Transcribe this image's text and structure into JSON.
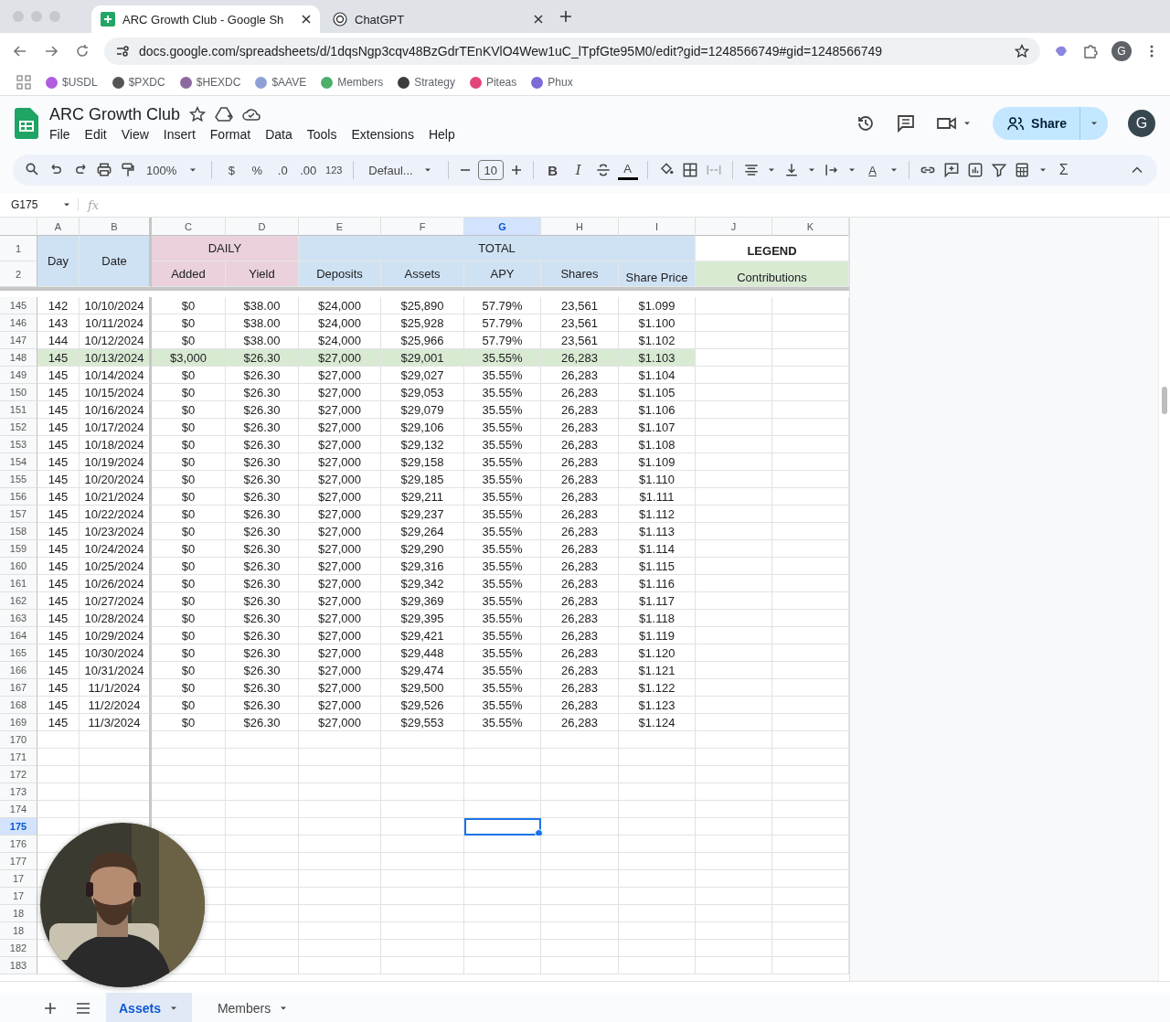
{
  "browser": {
    "tabs": [
      {
        "title": "ARC Growth Club - Google Sh",
        "selected": true,
        "kind": "sheets"
      },
      {
        "title": "ChatGPT",
        "selected": false,
        "kind": "chat"
      }
    ],
    "url": "docs.google.com/spreadsheets/d/1dqsNgp3cqv48BzGdrTEnKVlO4Wew1uC_lTpfGte95M0/edit?gid=1248566749#gid=1248566749",
    "profile": "G",
    "bookmarks": [
      {
        "label": "$USDL",
        "color": "#b05ce0"
      },
      {
        "label": "$PXDC",
        "color": "#555555"
      },
      {
        "label": "$HEXDC",
        "color": "#8a6a9e"
      },
      {
        "label": "$AAVE",
        "color": "#8fa0d8"
      },
      {
        "label": "Members",
        "color": "#4caf6a"
      },
      {
        "label": "Strategy",
        "color": "#3c3c3c"
      },
      {
        "label": "Piteas",
        "color": "#e0457b"
      },
      {
        "label": "Phux",
        "color": "#7b6bd6"
      }
    ]
  },
  "doc": {
    "title": "ARC Growth Club",
    "menu": [
      "File",
      "Edit",
      "View",
      "Insert",
      "Format",
      "Data",
      "Tools",
      "Extensions",
      "Help"
    ],
    "share": "Share",
    "avatar": "G"
  },
  "toolbar": {
    "zoom": "100%",
    "currency": "$",
    "percent": "%",
    "dec_decrease": ".0",
    "dec_increase": ".00",
    "number_format": "123",
    "font": "Defaul...",
    "font_size": "10",
    "bold": "B",
    "italic": "I",
    "text_color": "A",
    "text_rotation": "A",
    "sum": "Σ"
  },
  "name_box": "G175",
  "fx": "fx",
  "columns": [
    {
      "label": "A",
      "selected": false
    },
    {
      "label": "B",
      "selected": false
    },
    {
      "label": "C",
      "selected": false
    },
    {
      "label": "D",
      "selected": false
    },
    {
      "label": "E",
      "selected": false
    },
    {
      "label": "F",
      "selected": false
    },
    {
      "label": "G",
      "selected": true
    },
    {
      "label": "H",
      "selected": false
    },
    {
      "label": "I",
      "selected": false
    },
    {
      "label": "J",
      "selected": false
    },
    {
      "label": "K",
      "selected": false
    }
  ],
  "header": {
    "row_labels": [
      "1",
      "2"
    ],
    "day": "Day",
    "date": "Date",
    "daily": "DAILY",
    "total": "TOTAL",
    "legend": "LEGEND",
    "sub": [
      "Added",
      "Yield",
      "Deposits",
      "Assets",
      "APY",
      "Shares",
      "Share Price"
    ],
    "contributions": "Contributions"
  },
  "rows": [
    {
      "n": "145",
      "selected": false,
      "highlighted": false,
      "cells": [
        "142",
        "10/10/2024",
        "$0",
        "$38.00",
        "$24,000",
        "$25,890",
        "57.79%",
        "23,561",
        "$1.099"
      ]
    },
    {
      "n": "146",
      "selected": false,
      "highlighted": false,
      "cells": [
        "143",
        "10/11/2024",
        "$0",
        "$38.00",
        "$24,000",
        "$25,928",
        "57.79%",
        "23,561",
        "$1.100"
      ]
    },
    {
      "n": "147",
      "selected": false,
      "highlighted": false,
      "cells": [
        "144",
        "10/12/2024",
        "$0",
        "$38.00",
        "$24,000",
        "$25,966",
        "57.79%",
        "23,561",
        "$1.102"
      ]
    },
    {
      "n": "148",
      "selected": false,
      "highlighted": true,
      "cells": [
        "145",
        "10/13/2024",
        "$3,000",
        "$26.30",
        "$27,000",
        "$29,001",
        "35.55%",
        "26,283",
        "$1.103"
      ]
    },
    {
      "n": "149",
      "selected": false,
      "highlighted": false,
      "cells": [
        "145",
        "10/14/2024",
        "$0",
        "$26.30",
        "$27,000",
        "$29,027",
        "35.55%",
        "26,283",
        "$1.104"
      ]
    },
    {
      "n": "150",
      "selected": false,
      "highlighted": false,
      "cells": [
        "145",
        "10/15/2024",
        "$0",
        "$26.30",
        "$27,000",
        "$29,053",
        "35.55%",
        "26,283",
        "$1.105"
      ]
    },
    {
      "n": "151",
      "selected": false,
      "highlighted": false,
      "cells": [
        "145",
        "10/16/2024",
        "$0",
        "$26.30",
        "$27,000",
        "$29,079",
        "35.55%",
        "26,283",
        "$1.106"
      ]
    },
    {
      "n": "152",
      "selected": false,
      "highlighted": false,
      "cells": [
        "145",
        "10/17/2024",
        "$0",
        "$26.30",
        "$27,000",
        "$29,106",
        "35.55%",
        "26,283",
        "$1.107"
      ]
    },
    {
      "n": "153",
      "selected": false,
      "highlighted": false,
      "cells": [
        "145",
        "10/18/2024",
        "$0",
        "$26.30",
        "$27,000",
        "$29,132",
        "35.55%",
        "26,283",
        "$1.108"
      ]
    },
    {
      "n": "154",
      "selected": false,
      "highlighted": false,
      "cells": [
        "145",
        "10/19/2024",
        "$0",
        "$26.30",
        "$27,000",
        "$29,158",
        "35.55%",
        "26,283",
        "$1.109"
      ]
    },
    {
      "n": "155",
      "selected": false,
      "highlighted": false,
      "cells": [
        "145",
        "10/20/2024",
        "$0",
        "$26.30",
        "$27,000",
        "$29,185",
        "35.55%",
        "26,283",
        "$1.110"
      ]
    },
    {
      "n": "156",
      "selected": false,
      "highlighted": false,
      "cells": [
        "145",
        "10/21/2024",
        "$0",
        "$26.30",
        "$27,000",
        "$29,211",
        "35.55%",
        "26,283",
        "$1.111"
      ]
    },
    {
      "n": "157",
      "selected": false,
      "highlighted": false,
      "cells": [
        "145",
        "10/22/2024",
        "$0",
        "$26.30",
        "$27,000",
        "$29,237",
        "35.55%",
        "26,283",
        "$1.112"
      ]
    },
    {
      "n": "158",
      "selected": false,
      "highlighted": false,
      "cells": [
        "145",
        "10/23/2024",
        "$0",
        "$26.30",
        "$27,000",
        "$29,264",
        "35.55%",
        "26,283",
        "$1.113"
      ]
    },
    {
      "n": "159",
      "selected": false,
      "highlighted": false,
      "cells": [
        "145",
        "10/24/2024",
        "$0",
        "$26.30",
        "$27,000",
        "$29,290",
        "35.55%",
        "26,283",
        "$1.114"
      ]
    },
    {
      "n": "160",
      "selected": false,
      "highlighted": false,
      "cells": [
        "145",
        "10/25/2024",
        "$0",
        "$26.30",
        "$27,000",
        "$29,316",
        "35.55%",
        "26,283",
        "$1.115"
      ]
    },
    {
      "n": "161",
      "selected": false,
      "highlighted": false,
      "cells": [
        "145",
        "10/26/2024",
        "$0",
        "$26.30",
        "$27,000",
        "$29,342",
        "35.55%",
        "26,283",
        "$1.116"
      ]
    },
    {
      "n": "162",
      "selected": false,
      "highlighted": false,
      "cells": [
        "145",
        "10/27/2024",
        "$0",
        "$26.30",
        "$27,000",
        "$29,369",
        "35.55%",
        "26,283",
        "$1.117"
      ]
    },
    {
      "n": "163",
      "selected": false,
      "highlighted": false,
      "cells": [
        "145",
        "10/28/2024",
        "$0",
        "$26.30",
        "$27,000",
        "$29,395",
        "35.55%",
        "26,283",
        "$1.118"
      ]
    },
    {
      "n": "164",
      "selected": false,
      "highlighted": false,
      "cells": [
        "145",
        "10/29/2024",
        "$0",
        "$26.30",
        "$27,000",
        "$29,421",
        "35.55%",
        "26,283",
        "$1.119"
      ]
    },
    {
      "n": "165",
      "selected": false,
      "highlighted": false,
      "cells": [
        "145",
        "10/30/2024",
        "$0",
        "$26.30",
        "$27,000",
        "$29,448",
        "35.55%",
        "26,283",
        "$1.120"
      ]
    },
    {
      "n": "166",
      "selected": false,
      "highlighted": false,
      "cells": [
        "145",
        "10/31/2024",
        "$0",
        "$26.30",
        "$27,000",
        "$29,474",
        "35.55%",
        "26,283",
        "$1.121"
      ]
    },
    {
      "n": "167",
      "selected": false,
      "highlighted": false,
      "cells": [
        "145",
        "11/1/2024",
        "$0",
        "$26.30",
        "$27,000",
        "$29,500",
        "35.55%",
        "26,283",
        "$1.122"
      ]
    },
    {
      "n": "168",
      "selected": false,
      "highlighted": false,
      "cells": [
        "145",
        "11/2/2024",
        "$0",
        "$26.30",
        "$27,000",
        "$29,526",
        "35.55%",
        "26,283",
        "$1.123"
      ]
    },
    {
      "n": "169",
      "selected": false,
      "highlighted": false,
      "cells": [
        "145",
        "11/3/2024",
        "$0",
        "$26.30",
        "$27,000",
        "$29,553",
        "35.55%",
        "26,283",
        "$1.124"
      ]
    },
    {
      "n": "170",
      "selected": false,
      "highlighted": false
    },
    {
      "n": "171",
      "selected": false,
      "highlighted": false
    },
    {
      "n": "172",
      "selected": false,
      "highlighted": false
    },
    {
      "n": "173",
      "selected": false,
      "highlighted": false
    },
    {
      "n": "174",
      "selected": false,
      "highlighted": false
    },
    {
      "n": "175",
      "selected": true,
      "highlighted": false
    },
    {
      "n": "176",
      "selected": false,
      "highlighted": false
    },
    {
      "n": "177",
      "selected": false,
      "highlighted": false
    },
    {
      "n": "17",
      "selected": false,
      "highlighted": false
    },
    {
      "n": "17",
      "selected": false,
      "highlighted": false
    },
    {
      "n": "18",
      "selected": false,
      "highlighted": false
    },
    {
      "n": "18",
      "selected": false,
      "highlighted": false
    },
    {
      "n": "182",
      "selected": false,
      "highlighted": false
    },
    {
      "n": "183",
      "selected": false,
      "highlighted": false
    }
  ],
  "sheets": [
    {
      "label": "Assets",
      "selected": true
    },
    {
      "label": "Members",
      "selected": false
    }
  ]
}
